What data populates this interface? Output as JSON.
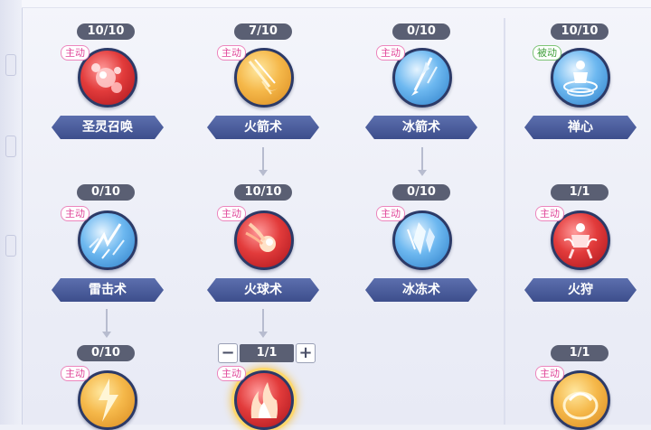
{
  "skills": [
    {
      "id": "sheng-ling-zhao-huan",
      "count": "10/10",
      "type": "主动",
      "name": "圣灵召唤",
      "color": "red",
      "icon": "spirit-orbs-icon"
    },
    {
      "id": "huo-jian-shu",
      "count": "7/10",
      "type": "主动",
      "name": "火箭术",
      "color": "orange",
      "icon": "fire-arrow-icon"
    },
    {
      "id": "bing-jian-shu",
      "count": "0/10",
      "type": "主动",
      "name": "冰箭术",
      "color": "blue",
      "icon": "ice-arrow-icon"
    },
    {
      "id": "chan-xin",
      "count": "10/10",
      "type": "被动",
      "name": "禅心",
      "color": "blue",
      "icon": "meditation-icon"
    },
    {
      "id": "lei-ji-shu",
      "count": "0/10",
      "type": "主动",
      "name": "雷击术",
      "color": "blue",
      "icon": "lightning-strike-icon"
    },
    {
      "id": "huo-qiu-shu",
      "count": "10/10",
      "type": "主动",
      "name": "火球术",
      "color": "red",
      "icon": "fireball-icon"
    },
    {
      "id": "bing-dong-shu",
      "count": "0/10",
      "type": "主动",
      "name": "冰冻术",
      "color": "blue",
      "icon": "ice-shard-icon"
    },
    {
      "id": "huo-shou",
      "count": "1/1",
      "type": "主动",
      "name": "火狩",
      "color": "red",
      "icon": "fire-hunter-icon"
    },
    {
      "id": "skill-row3-col1",
      "count": "0/10",
      "type": "主动",
      "color": "orange",
      "icon": "thunder-bolt-icon"
    },
    {
      "id": "skill-row3-col2",
      "count": "1/1",
      "type": "主动",
      "color": "red",
      "icon": "flame-burst-icon"
    },
    {
      "id": "skill-row3-col4",
      "count": "1/1",
      "type": "主动",
      "color": "orange",
      "icon": "golden-shield-icon"
    }
  ],
  "stepper": {
    "minus": "−",
    "value": "1/1",
    "plus": "+"
  }
}
